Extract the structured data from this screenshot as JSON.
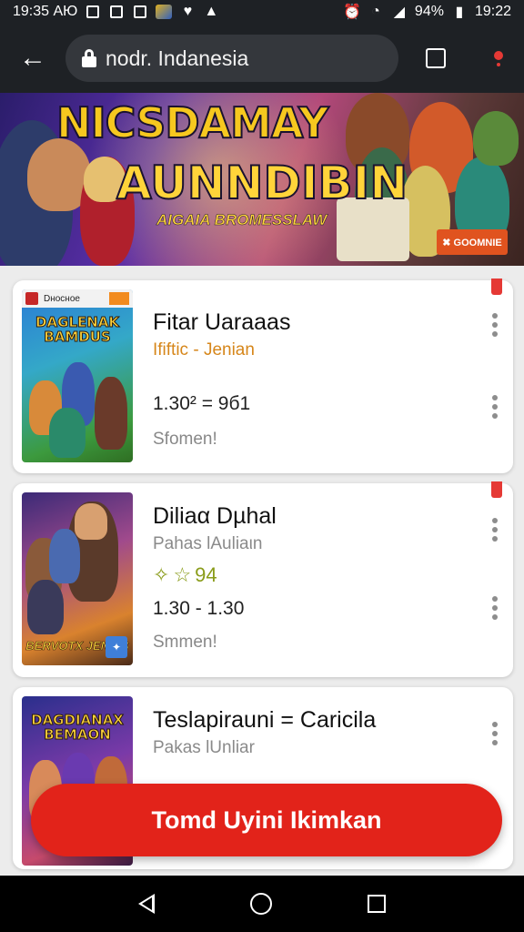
{
  "status_bar": {
    "left_time": "19:35 АЮ",
    "right_battery": "94%",
    "right_time": "19:22"
  },
  "browser": {
    "url_text": "nodr. Indanesia",
    "tab_count": ""
  },
  "hero": {
    "title": "NICSDAMAY",
    "subtitle": "AUNNDIBIN",
    "tagline": "AIGAIA BROMESSLAW",
    "badge": "✖ GOOMNIE"
  },
  "cards": [
    {
      "thumb_strip": "Dносное",
      "thumb_label": "DAGLENAK BAMDUS",
      "title": "Fitar Uaraaas",
      "subtitle": "Ififtic - Jenian",
      "subtitle_color": "#d6861a",
      "meta": "1.30² = 9б1",
      "status": "Sfomen!"
    },
    {
      "thumb_label": "",
      "thumb_bottom_label": "BERVOTX JENBIS",
      "title": "Diliaα Dµhal",
      "subtitle": "Pahas lAuliaιn",
      "subtitle_color": "#8a8a8a",
      "rating": "94",
      "meta": "1.30 - 1.30",
      "status": "Smmen!"
    },
    {
      "thumb_label": "DAGDIANAX BEMAON",
      "title": "Teslapirauni = Caricila",
      "subtitle": "Pakas lUnliar",
      "subtitle_color": "#8a8a8a"
    }
  ],
  "cta": {
    "label": "Tomd Uyini Ikimkan"
  }
}
